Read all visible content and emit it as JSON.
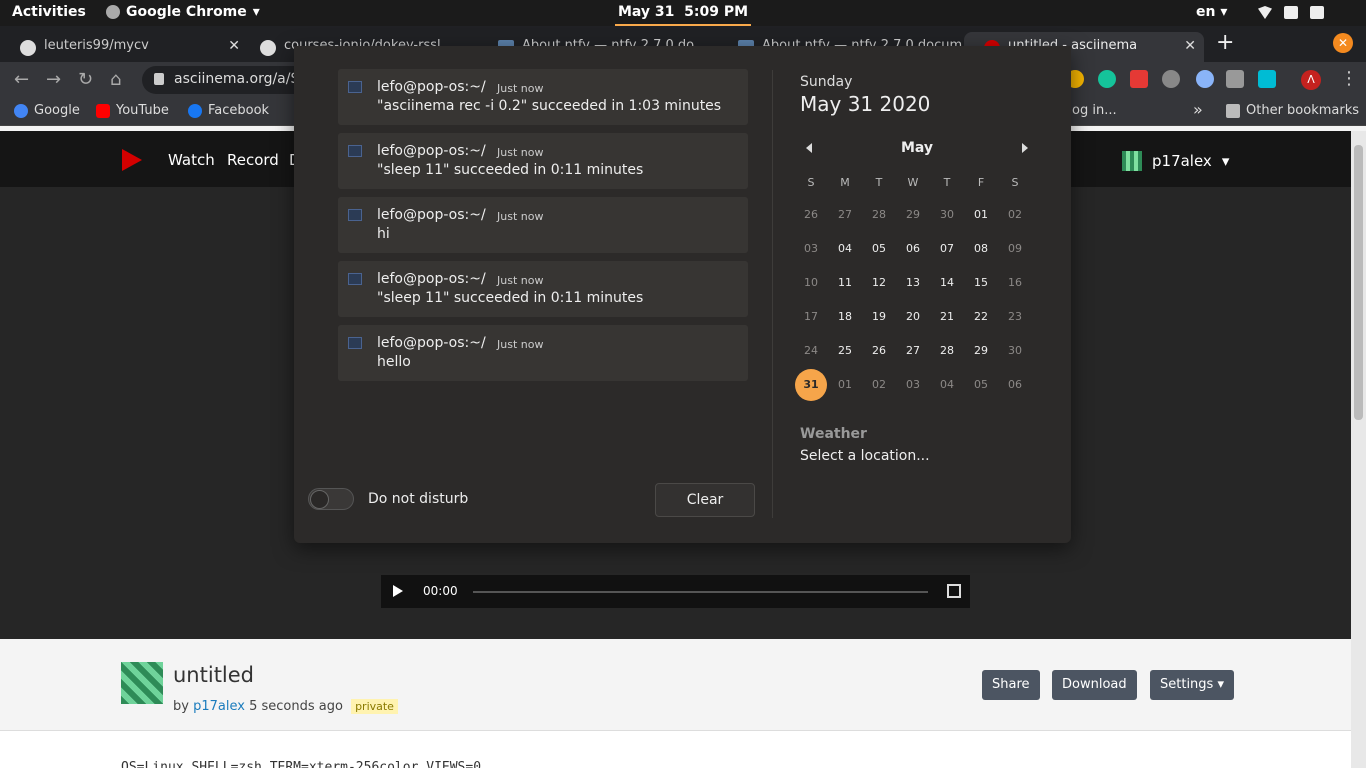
{
  "topbar": {
    "activities": "Activities",
    "app_name": "Google Chrome",
    "clock_date": "May 31",
    "clock_time": "5:09 PM",
    "lang": "en"
  },
  "tabs": [
    {
      "label": "leuteris99/mycv"
    },
    {
      "label": "courses-ionio/dokey-rssl"
    },
    {
      "label": "About ntfy — ntfy 2.7.0 do"
    },
    {
      "label": "About ntfy — ntfy 2.7.0 docum"
    },
    {
      "label": "untitled - asciinema"
    }
  ],
  "toolbar": {
    "url": "asciinema.org/a/S"
  },
  "bookmarks": {
    "google": "Google",
    "youtube": "YouTube",
    "facebook": "Facebook",
    "partial": "og in...",
    "more": "»",
    "other": "Other bookmarks"
  },
  "site": {
    "nav_watch": "Watch",
    "nav_record": "Record",
    "nav_partial": "D",
    "username": "p17alex",
    "player_time": "00:00",
    "title": "untitled",
    "by": "by",
    "author": "p17alex",
    "when": "5 seconds ago",
    "badge": "private",
    "share": "Share",
    "download": "Download",
    "settings": "Settings",
    "cmdline": "OS=Linux SHELL=zsh TERM=xterm-256color VIEWS=0"
  },
  "notifications": [
    {
      "title": "lefo@pop-os:~/",
      "time": "Just now",
      "body": "\"asciinema rec -i 0.2\" succeeded in 1:03 minutes"
    },
    {
      "title": "lefo@pop-os:~/",
      "time": "Just now",
      "body": "\"sleep 11\" succeeded in 0:11 minutes"
    },
    {
      "title": "lefo@pop-os:~/",
      "time": "Just now",
      "body": "hi"
    },
    {
      "title": "lefo@pop-os:~/",
      "time": "Just now",
      "body": "\"sleep 11\" succeeded in 0:11 minutes"
    },
    {
      "title": "lefo@pop-os:~/",
      "time": "Just now",
      "body": "hello"
    }
  ],
  "dnd_label": "Do not disturb",
  "clear_label": "Clear",
  "calendar": {
    "weekday": "Sunday",
    "full_date": "May 31 2020",
    "month": "May",
    "dow": [
      "S",
      "M",
      "T",
      "W",
      "T",
      "F",
      "S"
    ],
    "weeks": [
      [
        "26",
        "27",
        "28",
        "29",
        "30",
        "01",
        "02"
      ],
      [
        "03",
        "04",
        "05",
        "06",
        "07",
        "08",
        "09"
      ],
      [
        "10",
        "11",
        "12",
        "13",
        "14",
        "15",
        "16"
      ],
      [
        "17",
        "18",
        "19",
        "20",
        "21",
        "22",
        "23"
      ],
      [
        "24",
        "25",
        "26",
        "27",
        "28",
        "29",
        "30"
      ],
      [
        "31",
        "01",
        "02",
        "03",
        "04",
        "05",
        "06"
      ]
    ],
    "today": "31",
    "accent": "#f6a54a"
  },
  "weather": {
    "heading": "Weather",
    "location": "Select a location..."
  }
}
